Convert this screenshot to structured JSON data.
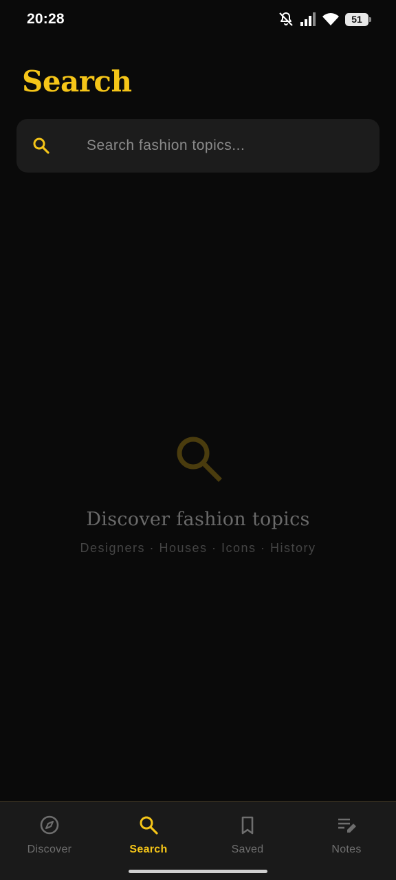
{
  "status_bar": {
    "time": "20:28",
    "battery": "51",
    "icons": [
      "bell-off-icon",
      "signal-icon",
      "wifi-icon",
      "battery-icon"
    ]
  },
  "page": {
    "title": "Search"
  },
  "search": {
    "placeholder": "Search fashion topics...",
    "value": ""
  },
  "empty_state": {
    "title": "Discover fashion topics",
    "subtitle": "Designers · Houses · Icons · History"
  },
  "bottom_nav": {
    "items": [
      {
        "label": "Discover",
        "icon": "compass-icon",
        "active": false
      },
      {
        "label": "Search",
        "icon": "search-icon",
        "active": true
      },
      {
        "label": "Saved",
        "icon": "bookmark-icon",
        "active": false
      },
      {
        "label": "Notes",
        "icon": "notes-edit-icon",
        "active": false
      }
    ]
  },
  "colors": {
    "accent": "#f5c518",
    "background": "#0a0a0a",
    "surface": "#1c1c1c",
    "muted_text": "#6e6e6e"
  }
}
